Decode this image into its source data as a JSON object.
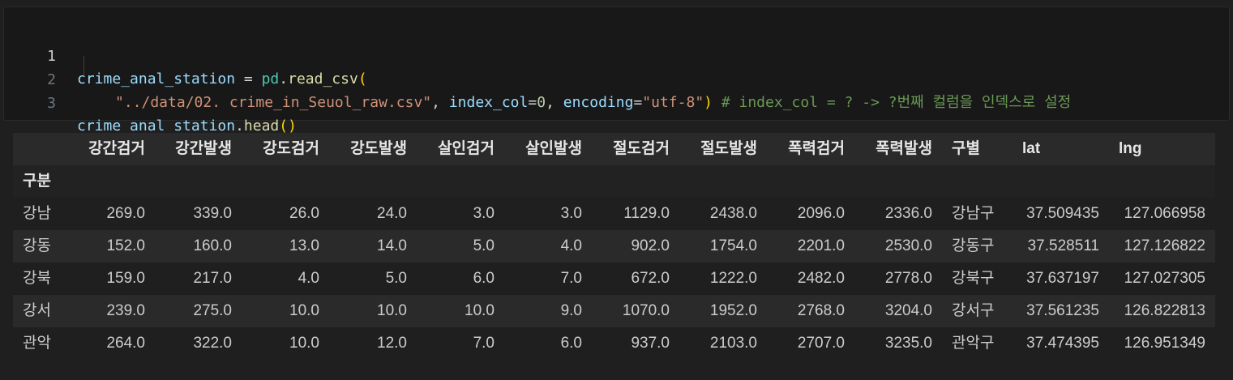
{
  "code_cell": {
    "line_numbers": [
      "1",
      "2",
      "3"
    ],
    "line1": {
      "var": "crime_anal_station",
      "eq": " = ",
      "mod": "pd",
      "dot": ".",
      "fn": "read_csv",
      "paren": "("
    },
    "line2": {
      "str": "\"../data/02. crime_in_Seuol_raw.csv\"",
      "comma1": ", ",
      "p1": "index_col",
      "eq1": "=",
      "n1": "0",
      "comma2": ", ",
      "p2": "encoding",
      "eq2": "=",
      "s2": "\"utf-8\"",
      "paren": ")",
      "comment": " # index_col = ? -> ?번째 컬럼을 인덱스로 설정"
    },
    "line3": {
      "var": "crime_anal_station",
      "dot": ".",
      "fn": "head",
      "paren": "()"
    }
  },
  "table": {
    "columns": [
      "강간검거",
      "강간발생",
      "강도검거",
      "강도발생",
      "살인검거",
      "살인발생",
      "절도검거",
      "절도발생",
      "폭력검거",
      "폭력발생",
      "구별",
      "lat",
      "lng"
    ],
    "index_name": "구분",
    "rows": [
      {
        "index": "강남",
        "values": [
          "269.0",
          "339.0",
          "26.0",
          "24.0",
          "3.0",
          "3.0",
          "1129.0",
          "2438.0",
          "2096.0",
          "2336.0",
          "강남구",
          "37.509435",
          "127.066958"
        ]
      },
      {
        "index": "강동",
        "values": [
          "152.0",
          "160.0",
          "13.0",
          "14.0",
          "5.0",
          "4.0",
          "902.0",
          "1754.0",
          "2201.0",
          "2530.0",
          "강동구",
          "37.528511",
          "127.126822"
        ]
      },
      {
        "index": "강북",
        "values": [
          "159.0",
          "217.0",
          "4.0",
          "5.0",
          "6.0",
          "7.0",
          "672.0",
          "1222.0",
          "2482.0",
          "2778.0",
          "강북구",
          "37.637197",
          "127.027305"
        ]
      },
      {
        "index": "강서",
        "values": [
          "239.0",
          "275.0",
          "10.0",
          "10.0",
          "10.0",
          "9.0",
          "1070.0",
          "1952.0",
          "2768.0",
          "3204.0",
          "강서구",
          "37.561235",
          "126.822813"
        ]
      },
      {
        "index": "관악",
        "values": [
          "264.0",
          "322.0",
          "10.0",
          "12.0",
          "7.0",
          "6.0",
          "937.0",
          "2103.0",
          "2707.0",
          "3235.0",
          "관악구",
          "37.474395",
          "126.951349"
        ]
      }
    ]
  }
}
